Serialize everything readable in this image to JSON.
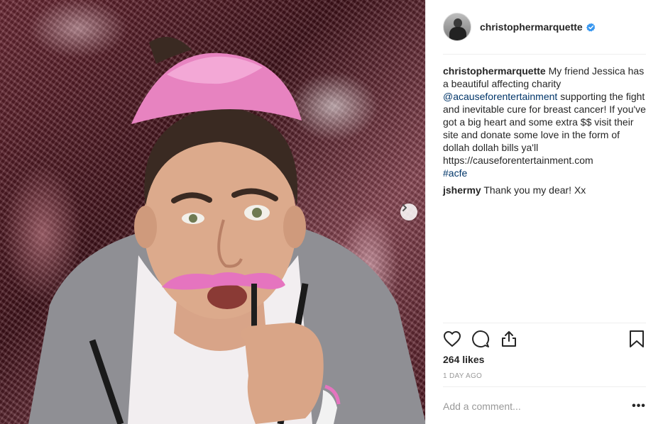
{
  "post": {
    "author": "christophermarquette",
    "verified": true,
    "caption": {
      "lead": "My friend Jessica has a beautiful affecting charity",
      "mention": "@acauseforentertainment",
      "body": "supporting the fight and inevitable cure for breast cancer! If you've got a big heart and some extra $$ visit their site and donate some love in the form of dollah dollah bills ya'll",
      "link": "https://causeforentertainment.com",
      "hashtag": "#acfe"
    },
    "comments": [
      {
        "user": "jshermy",
        "text": "Thank you my dear! Xx"
      }
    ],
    "likes": "264 likes",
    "timestamp": "1 DAY AGO"
  },
  "composer": {
    "placeholder": "Add a comment...",
    "more_label": "•••"
  },
  "icons": {
    "like": "heart-outline-icon",
    "comment": "comment-bubble-icon",
    "share": "share-icon",
    "save": "bookmark-icon",
    "next": "chevron-right-icon",
    "verified": "verified-badge-icon"
  },
  "colors": {
    "link": "#003569",
    "verified": "#3897f0",
    "muted": "#999999",
    "text": "#262626"
  }
}
